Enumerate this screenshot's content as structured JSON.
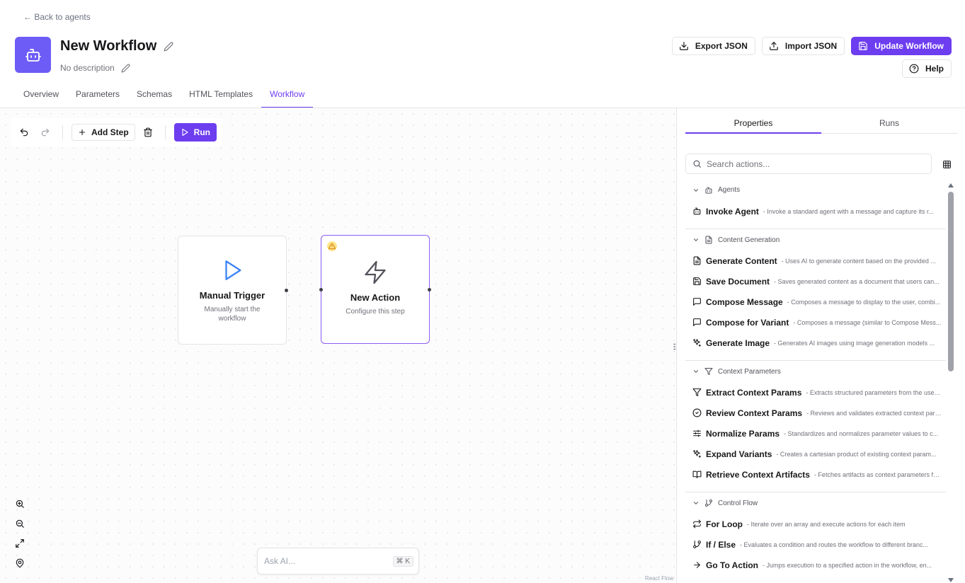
{
  "header": {
    "back_label": "← Back to agents",
    "title": "New Workflow",
    "description": "No description",
    "export_label": "Export JSON",
    "import_label": "Import JSON",
    "update_label": "Update Workflow",
    "help_label": "Help"
  },
  "tabs": [
    {
      "label": "Overview"
    },
    {
      "label": "Parameters"
    },
    {
      "label": "Schemas"
    },
    {
      "label": "HTML Templates"
    },
    {
      "label": "Workflow",
      "active": true
    }
  ],
  "toolbar": {
    "add_step_label": "Add Step",
    "run_label": "Run"
  },
  "nodes": {
    "trigger": {
      "title": "Manual Trigger",
      "subtitle": "Manually start the workflow"
    },
    "action": {
      "title": "New Action",
      "subtitle": "Configure this step"
    }
  },
  "ask_ai": {
    "placeholder": "Ask AI...",
    "shortcut": "⌘ K"
  },
  "attribution": "React Flow",
  "panel": {
    "tabs": [
      {
        "label": "Properties",
        "active": true
      },
      {
        "label": "Runs"
      }
    ],
    "search_placeholder": "Search actions...",
    "categories": [
      {
        "name": "Agents",
        "items": [
          {
            "name": "Invoke Agent",
            "desc": "- Invoke a standard agent with a message and capture its r..."
          }
        ]
      },
      {
        "name": "Content Generation",
        "items": [
          {
            "name": "Generate Content",
            "desc": "- Uses AI to generate content based on the provided ..."
          },
          {
            "name": "Save Document",
            "desc": "- Saves generated content as a document that users can..."
          },
          {
            "name": "Compose Message",
            "desc": "- Composes a message to display to the user, combi..."
          },
          {
            "name": "Compose for Variant",
            "desc": "- Composes a message (similar to Compose Mess..."
          },
          {
            "name": "Generate Image",
            "desc": "- Generates AI images using image generation models ..."
          }
        ]
      },
      {
        "name": "Context Parameters",
        "items": [
          {
            "name": "Extract Context Params",
            "desc": "- Extracts structured parameters from the user ..."
          },
          {
            "name": "Review Context Params",
            "desc": "- Reviews and validates extracted context para..."
          },
          {
            "name": "Normalize Params",
            "desc": "- Standardizes and normalizes parameter values to c..."
          },
          {
            "name": "Expand Variants",
            "desc": "- Creates a cartesian product of existing context param..."
          },
          {
            "name": "Retrieve Context Artifacts",
            "desc": "- Fetches artifacts as context parameters for..."
          }
        ]
      },
      {
        "name": "Control Flow",
        "items": [
          {
            "name": "For Loop",
            "desc": "- Iterate over an array and execute actions for each item"
          },
          {
            "name": "If / Else",
            "desc": "- Evaluates a condition and routes the workflow to different branc..."
          },
          {
            "name": "Go To Action",
            "desc": "- Jumps execution to a specified action in the workflow, en..."
          }
        ]
      }
    ]
  },
  "colors": {
    "accent": "#6d3df0",
    "warning": "#fde68a"
  }
}
